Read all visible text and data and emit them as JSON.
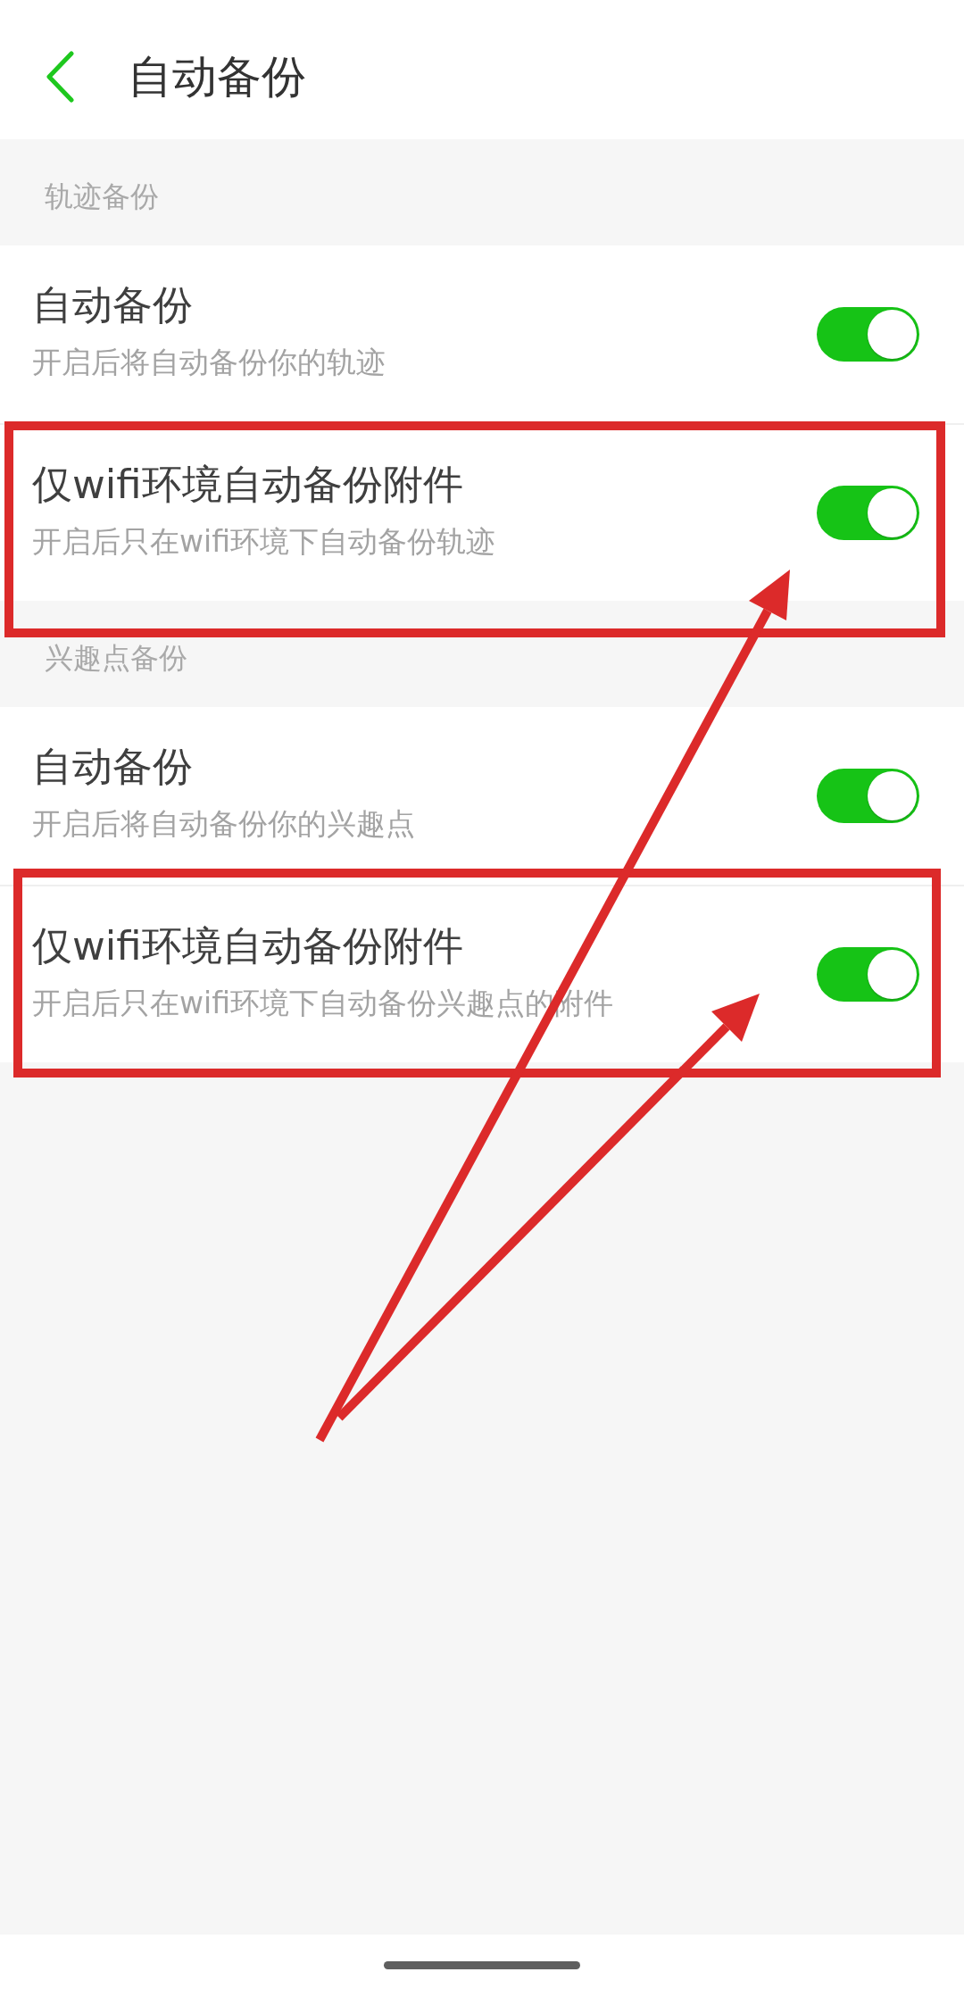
{
  "header": {
    "title": "自动备份"
  },
  "sections": [
    {
      "title": "轨迹备份",
      "items": [
        {
          "title": "自动备份",
          "subtitle": "开启后将自动备份你的轨迹",
          "on": true,
          "highlighted": false
        },
        {
          "title": "仅wifi环境自动备份附件",
          "subtitle": "开启后只在wifi环境下自动备份轨迹",
          "on": true,
          "highlighted": true
        }
      ]
    },
    {
      "title": "兴趣点备份",
      "items": [
        {
          "title": "自动备份",
          "subtitle": "开启后将自动备份你的兴趣点",
          "on": true,
          "highlighted": false
        },
        {
          "title": "仅wifi环境自动备份附件",
          "subtitle": "开启后只在wifi环境下自动备份兴趣点的附件",
          "on": true,
          "highlighted": true
        }
      ]
    }
  ]
}
